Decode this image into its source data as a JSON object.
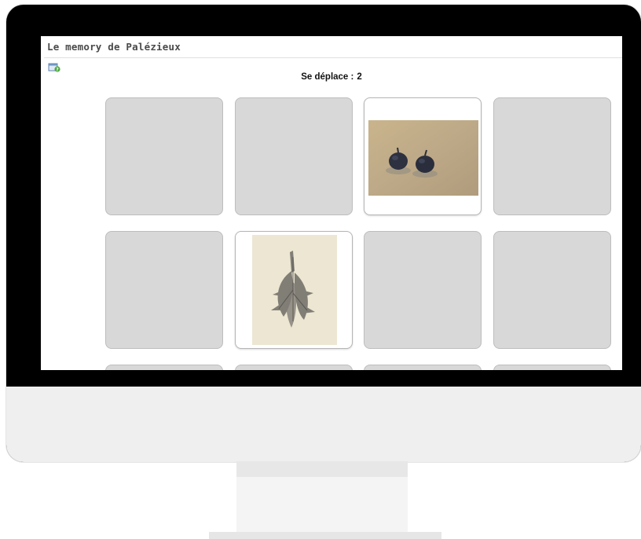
{
  "app": {
    "title": "Le memory de Palézieux"
  },
  "status": {
    "label": "Se déplace :",
    "moves": "2"
  },
  "cards": [
    {
      "row": 1,
      "col": 1,
      "state": "face-down"
    },
    {
      "row": 1,
      "col": 2,
      "state": "face-down"
    },
    {
      "row": 1,
      "col": 3,
      "state": "face-up",
      "image": "two-figs-painting"
    },
    {
      "row": 1,
      "col": 4,
      "state": "face-down"
    },
    {
      "row": 2,
      "col": 1,
      "state": "face-down"
    },
    {
      "row": 2,
      "col": 2,
      "state": "face-up",
      "image": "branch-drawing"
    },
    {
      "row": 2,
      "col": 3,
      "state": "face-down"
    },
    {
      "row": 2,
      "col": 4,
      "state": "face-down"
    },
    {
      "row": 3,
      "col": 1,
      "state": "face-down"
    },
    {
      "row": 3,
      "col": 2,
      "state": "face-down"
    },
    {
      "row": 3,
      "col": 3,
      "state": "face-down"
    },
    {
      "row": 3,
      "col": 4,
      "state": "face-down"
    }
  ]
}
